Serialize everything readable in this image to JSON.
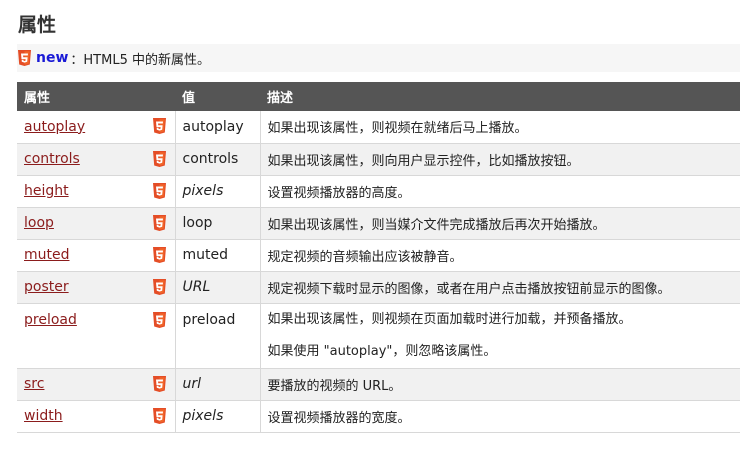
{
  "section": {
    "title": "属性"
  },
  "intro": {
    "badge_icon": "html5-icon",
    "new_word": "new",
    "description": "：HTML5 中的新属性。"
  },
  "colors": {
    "header_bg": "#555555",
    "link": "#8b1c1c",
    "new_word": "#1a1ad6",
    "html5_orange": "#e44d26"
  },
  "table": {
    "headers": [
      "属性",
      "值",
      "描述"
    ],
    "rows": [
      {
        "name": "autoplay",
        "value": "autoplay",
        "value_italic": false,
        "description": [
          "如果出现该属性，则视频在就绪后马上播放。"
        ]
      },
      {
        "name": "controls",
        "value": "controls",
        "value_italic": false,
        "description": [
          "如果出现该属性，则向用户显示控件，比如播放按钮。"
        ]
      },
      {
        "name": "height",
        "value": "pixels",
        "value_italic": true,
        "description": [
          "设置视频播放器的高度。"
        ]
      },
      {
        "name": "loop",
        "value": "loop",
        "value_italic": false,
        "description": [
          "如果出现该属性，则当媒介文件完成播放后再次开始播放。"
        ]
      },
      {
        "name": "muted",
        "value": "muted",
        "value_italic": false,
        "description": [
          "规定视频的音频输出应该被静音。"
        ]
      },
      {
        "name": "poster",
        "value": "URL",
        "value_italic": true,
        "description": [
          "规定视频下载时显示的图像，或者在用户点击播放按钮前显示的图像。"
        ]
      },
      {
        "name": "preload",
        "value": "preload",
        "value_italic": false,
        "description": [
          "如果出现该属性，则视频在页面加载时进行加载，并预备播放。",
          "如果使用 \"autoplay\"，则忽略该属性。"
        ]
      },
      {
        "name": "src",
        "value": "url",
        "value_italic": true,
        "description": [
          "要播放的视频的 URL。"
        ]
      },
      {
        "name": "width",
        "value": "pixels",
        "value_italic": true,
        "description": [
          "设置视频播放器的宽度。"
        ]
      }
    ]
  }
}
